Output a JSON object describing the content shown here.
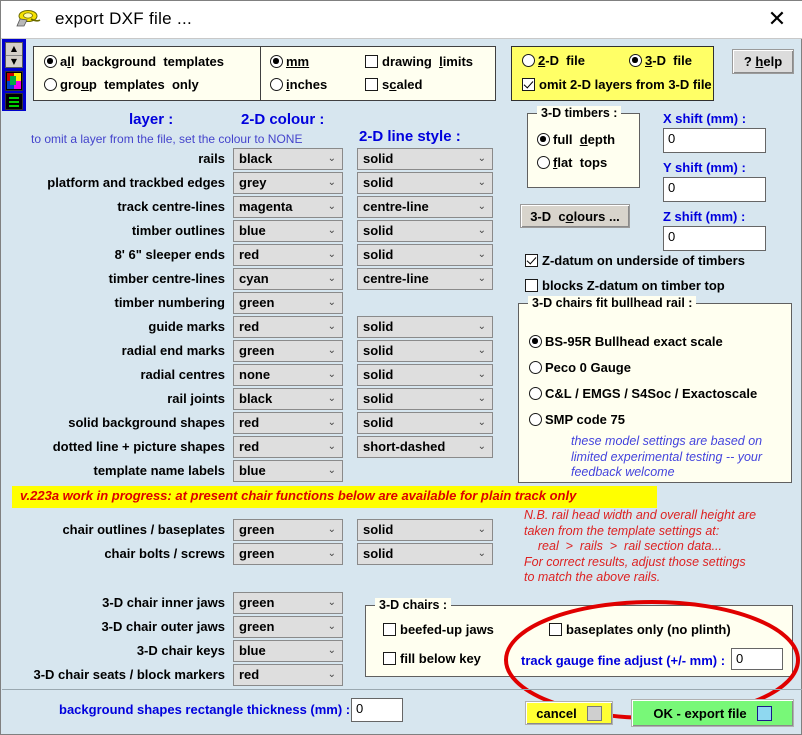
{
  "window": {
    "title": "export  DXF  file ...",
    "icon": "clamp-icon",
    "close_label": "✕"
  },
  "leftrail": {
    "spin_up": "▲",
    "spin_down": "▼",
    "colour_icon": "colour-palette-icon",
    "lines_icon": "line-style-icon"
  },
  "top": {
    "templates_group": {
      "options": [
        {
          "label_pre": "a",
          "label_u": "ll",
          "label_post": "  background  templates",
          "selected": true
        },
        {
          "label_pre": "gro",
          "label_u": "u",
          "label_post": "p  templates  only",
          "selected": false
        }
      ]
    },
    "units_group": {
      "radios": [
        {
          "label_pre": "",
          "label_u": "mm",
          "label_post": "",
          "selected": true
        },
        {
          "label_pre": "",
          "label_u": "i",
          "label_post": "nches",
          "selected": false
        }
      ],
      "checks": [
        {
          "label_pre": "drawing  ",
          "label_u": "l",
          "label_post": "imits",
          "checked": false
        },
        {
          "label_pre": "s",
          "label_u": "c",
          "label_post": "aled",
          "checked": false
        }
      ]
    },
    "file_group": {
      "radios": [
        {
          "label_pre": "",
          "label_u": "2",
          "label_post": "-D  file",
          "selected": false
        },
        {
          "label_pre": "",
          "label_u": "3",
          "label_post": "-D  file",
          "selected": true
        }
      ],
      "omit_check": {
        "label": "omit 2-D layers from 3-D file",
        "checked": true
      }
    },
    "help_button": "? help",
    "help_button_pre": "? ",
    "help_button_u": "h",
    "help_button_post": "elp"
  },
  "headers": {
    "layer": "layer :",
    "colour": "2-D  colour :",
    "line_style": "2-D  line  style :",
    "hint": "to omit a layer from the file, set the colour to NONE"
  },
  "layers": [
    {
      "label": "rails",
      "colour": "black",
      "style": "solid"
    },
    {
      "label": "platform  and  trackbed  edges",
      "colour": "grey",
      "style": "solid"
    },
    {
      "label": "track  centre-lines",
      "colour": "magenta",
      "style": "centre-line"
    },
    {
      "label": "timber  outlines",
      "colour": "blue",
      "style": "solid"
    },
    {
      "label": "8' 6\"  sleeper  ends",
      "colour": "red",
      "style": "solid"
    },
    {
      "label": "timber  centre-lines",
      "colour": "cyan",
      "style": "centre-line"
    },
    {
      "label": "timber  numbering",
      "colour": "green",
      "style": null
    },
    {
      "label": "guide  marks",
      "colour": "red",
      "style": "solid"
    },
    {
      "label": "radial  end  marks",
      "colour": "green",
      "style": "solid"
    },
    {
      "label": "radial  centres",
      "colour": "none",
      "style": "solid"
    },
    {
      "label": "rail  joints",
      "colour": "black",
      "style": "solid"
    },
    {
      "label": "solid  background  shapes",
      "colour": "red",
      "style": "solid"
    },
    {
      "label": "dotted  line  +  picture  shapes",
      "colour": "red",
      "style": "short-dashed"
    },
    {
      "label": "template  name  labels",
      "colour": "blue",
      "style": null
    }
  ],
  "warning": "v.223a  work in progress:  at present chair functions below are available for plain track only",
  "chair_layers": [
    {
      "label": "chair  outlines / baseplates",
      "colour": "green",
      "style": "solid"
    },
    {
      "label": "chair  bolts / screws",
      "colour": "green",
      "style": "solid"
    }
  ],
  "chair3d_layers": [
    {
      "label": "3-D  chair  inner  jaws",
      "colour": "green"
    },
    {
      "label": "3-D  chair  outer  jaws",
      "colour": "green"
    },
    {
      "label": "3-D  chair  keys",
      "colour": "blue"
    },
    {
      "label": "3-D  chair  seats  /  block  markers",
      "colour": "red"
    }
  ],
  "right": {
    "timbers_group": {
      "title": "3-D  timbers :",
      "options": [
        {
          "label_pre": "full  ",
          "label_u": "d",
          "label_post": "epth",
          "selected": true
        },
        {
          "label_pre": "",
          "label_u": "f",
          "label_post": "lat  tops",
          "selected": false
        }
      ]
    },
    "colours_button_pre": "3-D  c",
    "colours_button_u": "o",
    "colours_button_post": "lours ...",
    "shifts": [
      {
        "label": "X shift (mm) :",
        "value": "0"
      },
      {
        "label": "Y shift (mm) :",
        "value": "0"
      },
      {
        "label": "Z shift (mm) :",
        "value": "0"
      }
    ],
    "zdatum_checks": [
      {
        "label": "Z-datum on underside of timbers",
        "checked": true
      },
      {
        "label": "blocks Z-datum on timber top",
        "checked": false
      }
    ],
    "bullhead_group": {
      "title": "3-D  chairs  fit  bullhead  rail :",
      "options": [
        {
          "label": "BS-95R Bullhead exact scale",
          "selected": true
        },
        {
          "label": "Peco  0  Gauge",
          "selected": false
        },
        {
          "label": "C&L / EMGS / S4Soc / Exactoscale",
          "selected": false
        },
        {
          "label": "SMP code 75",
          "selected": false
        }
      ],
      "note": [
        "these model settings are based on",
        "limited experimental testing -- your",
        "feedback welcome"
      ]
    },
    "rail_note": [
      "N.B. rail head width and overall height are",
      "taken from the template settings at:",
      "    real  >  rails  >  rail section data...",
      "For correct results, adjust those settings",
      "to match the above rails."
    ]
  },
  "chairs_box": {
    "title": "3-D  chairs :",
    "checks": [
      {
        "label": "beefed-up  jaws",
        "checked": false
      },
      {
        "label": "fill  below  key",
        "checked": false
      },
      {
        "label": "baseplates  only  (no plinth)",
        "checked": false
      }
    ],
    "gauge_label": "track gauge fine adjust (+/- mm) :",
    "gauge_value": "0"
  },
  "bottom": {
    "bg_thickness_label": "background shapes rectangle thickness (mm) :",
    "bg_thickness_value": "0",
    "cancel_label": "cancel",
    "ok_label": "OK  -  export  file"
  },
  "colors": {
    "dialog_bg": "#d7e6ef",
    "panel_bg": "#fffff0",
    "accent_blue": "#0000dd",
    "warn_yellow": "#ffff00",
    "warn_red": "#dd0000",
    "ok_green": "#78f878",
    "cancel_yellow": "#ffff33",
    "annotation_red": "#e00000"
  }
}
